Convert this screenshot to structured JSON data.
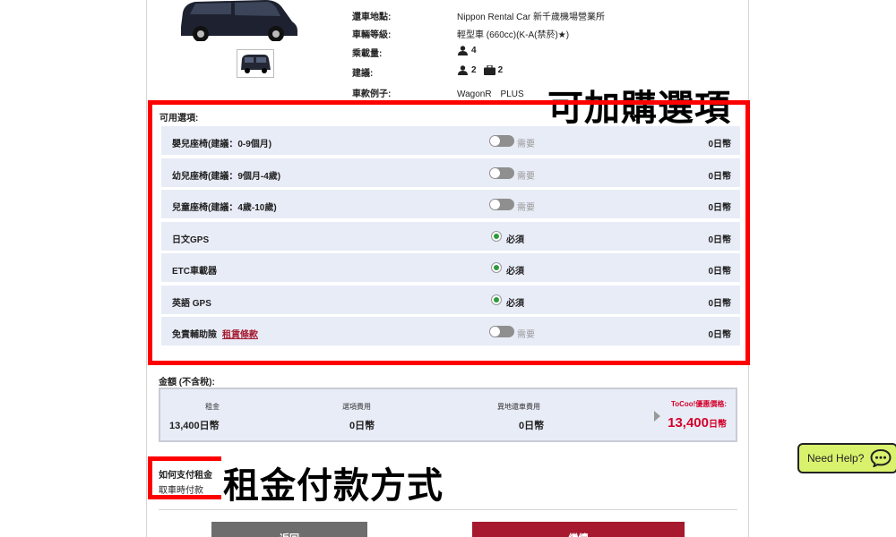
{
  "car": {
    "info": [
      {
        "label": "還車地點:",
        "value": "Nippon Rental Car 新千歲機場營業所"
      },
      {
        "label": "車輛等級:",
        "value": "輕型車 (660cc)(K-A(禁菸)★)"
      },
      {
        "label": "乘載量:",
        "people": "4"
      },
      {
        "label": "建議:",
        "people": "2",
        "bags": "2"
      },
      {
        "label": "車款例子:",
        "value": "WagonR　PLUS"
      }
    ]
  },
  "options": {
    "annotation": "可加購選項",
    "title": "可用選項:",
    "items": [
      {
        "name": "嬰兒座椅(建議：0-9個月)",
        "control": "toggle",
        "control_label": "需要",
        "price": "0日幣"
      },
      {
        "name": "幼兒座椅(建議：9個月-4歲)",
        "control": "toggle",
        "control_label": "需要",
        "price": "0日幣"
      },
      {
        "name": "兒童座椅(建議：4歲-10歲)",
        "control": "toggle",
        "control_label": "需要",
        "price": "0日幣"
      },
      {
        "name": "日文GPS",
        "control": "radio",
        "control_label": "必須",
        "price": "0日幣"
      },
      {
        "name": "ETC車載器",
        "control": "radio",
        "control_label": "必須",
        "price": "0日幣"
      },
      {
        "name": "英語 GPS",
        "control": "radio",
        "control_label": "必須",
        "price": "0日幣"
      },
      {
        "name": "免責輔助險",
        "link": "租賃條款",
        "control": "toggle",
        "control_label": "需要",
        "price": "0日幣"
      }
    ]
  },
  "amount": {
    "title": "金額 (不含稅):",
    "columns": [
      {
        "label": "租金",
        "value": "13,400日幣"
      },
      {
        "label": "選項費用",
        "value": "0日幣"
      },
      {
        "label": "異地還車費用",
        "value": "0日幣"
      }
    ],
    "promo_label": "ToCoo!優惠價格:",
    "promo_value": "13,400",
    "promo_unit": "日幣"
  },
  "payment": {
    "title": "如何支付租金",
    "value": "取車時付款",
    "annotation": "租金付款方式"
  },
  "buttons": {
    "back": "返回",
    "next": "繼續"
  },
  "help": {
    "label": "Need Help?"
  },
  "colors": {
    "annotation_red": "#ff0000",
    "brand_red": "#a6192e",
    "promo_red": "#d4002a",
    "row_bg": "#e8ecf7",
    "help_green": "#d8f26e"
  }
}
